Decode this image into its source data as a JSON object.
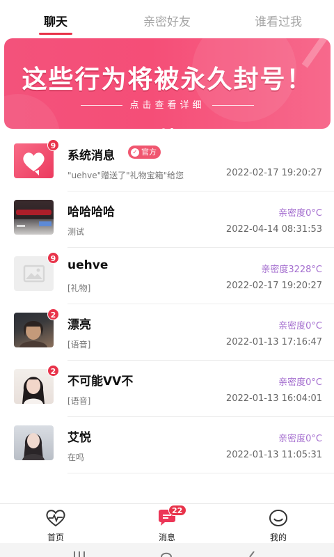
{
  "tabs": [
    {
      "label": "聊天",
      "active": true
    },
    {
      "label": "亲密好友",
      "active": false
    },
    {
      "label": "谁看过我",
      "active": false
    }
  ],
  "banner": {
    "title": "这些行为将被永久封号！",
    "subtitle": "点击查看详细",
    "slide_count": 2,
    "active_slide": 2
  },
  "chats": [
    {
      "name": "系统消息",
      "tag": "官方",
      "badge": "9",
      "intimacy": "",
      "preview": "\"uehve\"赠送了\"礼物宝箱\"给您",
      "time": "2022-02-17 19:20:27",
      "avatar": "heart-avatar"
    },
    {
      "name": "哈哈哈哈",
      "tag": "",
      "badge": "",
      "intimacy": "亲密度0°C",
      "preview": "测试",
      "time": "2022-04-14 08:31:53",
      "avatar": "car-photo-avatar"
    },
    {
      "name": "uehve",
      "tag": "",
      "badge": "9",
      "intimacy": "亲密度3228°C",
      "preview": "[礼物]",
      "time": "2022-02-17 19:20:27",
      "avatar": "image-placeholder-avatar"
    },
    {
      "name": "漂亮",
      "tag": "",
      "badge": "2",
      "intimacy": "亲密度0°C",
      "preview": "[语音]",
      "time": "2022-01-13 17:16:47",
      "avatar": "portrait-avatar"
    },
    {
      "name": "不可能VV不",
      "tag": "",
      "badge": "2",
      "intimacy": "亲密度0°C",
      "preview": "[语音]",
      "time": "2022-01-13 16:04:01",
      "avatar": "portrait-avatar"
    },
    {
      "name": "艾悦",
      "tag": "",
      "badge": "",
      "intimacy": "亲密度0°C",
      "preview": "在吗",
      "time": "2022-01-13 11:05:31",
      "avatar": "portrait-avatar"
    }
  ],
  "nav": {
    "home": "首页",
    "messages": "消息",
    "messages_badge": "22",
    "mine": "我的"
  },
  "colors": {
    "accent": "#e8334a",
    "intimacy": "#a46ecf",
    "banner": "#f54e77"
  }
}
